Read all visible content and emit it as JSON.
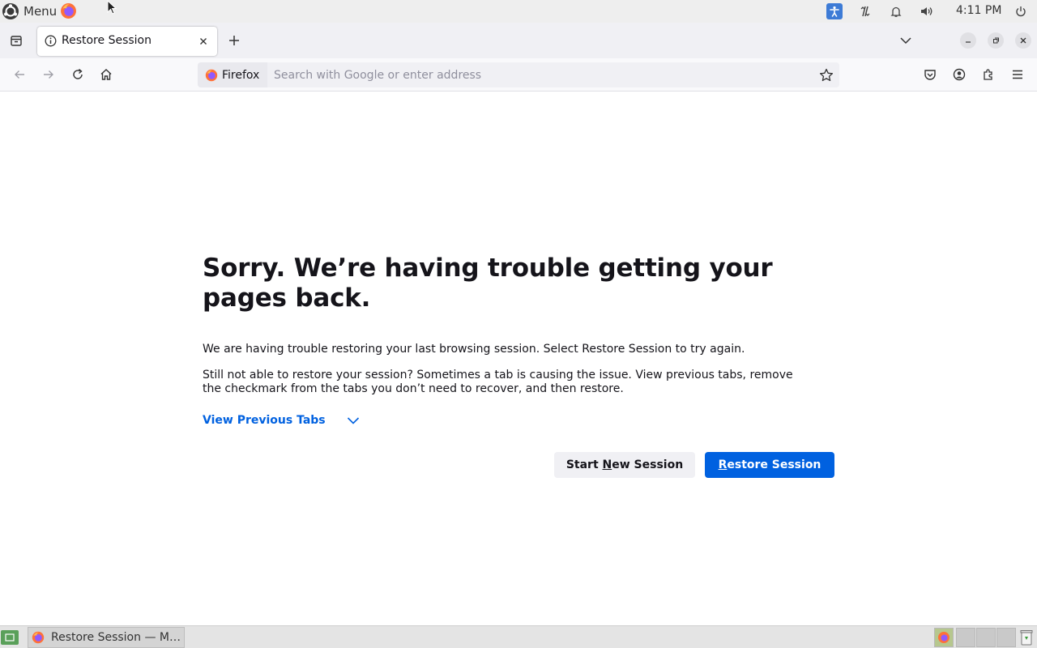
{
  "top_panel": {
    "menu_label": "Menu",
    "clock": "4:11 PM",
    "icons": [
      "menu-logo-icon",
      "firefox-launcher-icon",
      "accessibility-icon",
      "network-icon",
      "notification-bell-icon",
      "volume-icon",
      "power-icon"
    ]
  },
  "tabs": {
    "active_title": "Restore Session",
    "icons": [
      "tab-overview-icon",
      "info-icon",
      "close-icon",
      "plus-icon",
      "chevron-down-icon"
    ]
  },
  "nav": {
    "identity_label": "Firefox",
    "url_placeholder": "Search with Google or enter address",
    "url_value": ""
  },
  "page": {
    "title": "Sorry. We’re having trouble getting your pages back.",
    "description_1": "We are having trouble restoring your last browsing session. Select Restore Session to try again.",
    "description_2": "Still not able to restore your session? Sometimes a tab is causing the issue. View previous tabs, remove the checkmark from the tabs you don’t need to recover, and then restore.",
    "view_previous_tabs": "View Previous Tabs",
    "start_new_session": {
      "before": "Start ",
      "accel": "N",
      "after": "ew Session"
    },
    "restore_session": {
      "before": "",
      "accel": "R",
      "after": "estore Session"
    }
  },
  "taskbar": {
    "task_label": "Restore Session — M…"
  },
  "colors": {
    "accent_blue": "#0061e0",
    "tab_strip": "#f0f0f4",
    "panel": "#eeeeee"
  }
}
